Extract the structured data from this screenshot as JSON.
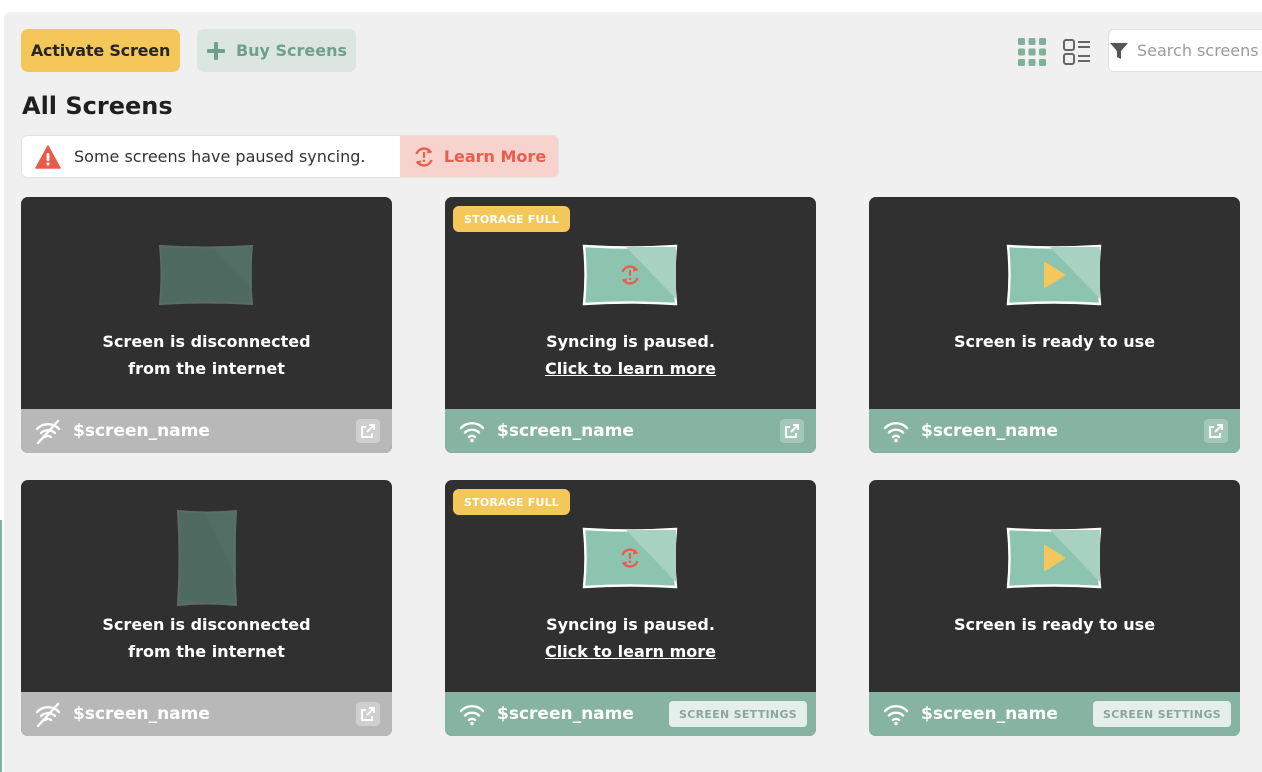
{
  "toolbar": {
    "activate_label": "Activate Screen",
    "buy_label": "Buy Screens",
    "search_placeholder": "Search screens"
  },
  "page": {
    "title": "All Screens"
  },
  "alert": {
    "message": "Some screens have paused syncing.",
    "learn_more_label": "Learn More"
  },
  "colors": {
    "accent_yellow": "#f4c75a",
    "accent_green": "#87b4a2",
    "alert_red": "#ea5d4b",
    "card_dark": "#2f302f",
    "offline_gray": "#b8b8b8"
  },
  "cards": [
    {
      "state": "disconnected",
      "orientation": "landscape",
      "status_line1": "Screen is disconnected",
      "status_line2": "from the internet",
      "name": "$screen_name",
      "connection_icon": "wifi-off-icon",
      "action_icon": "external-link-icon"
    },
    {
      "state": "paused",
      "orientation": "landscape",
      "badge": "STORAGE FULL",
      "status_line1": "Syncing is paused.",
      "status_link": "Click to learn more",
      "name": "$screen_name",
      "connection_icon": "wifi-icon",
      "action_icon": "external-link-icon"
    },
    {
      "state": "ready",
      "orientation": "landscape",
      "status_line1": "Screen is ready to use",
      "name": "$screen_name",
      "connection_icon": "wifi-icon",
      "action_icon": "external-link-icon"
    },
    {
      "state": "disconnected",
      "orientation": "portrait",
      "status_line1": "Screen is disconnected",
      "status_line2": "from the internet",
      "name": "$screen_name",
      "connection_icon": "wifi-off-icon",
      "action_icon": "external-link-icon"
    },
    {
      "state": "paused",
      "orientation": "landscape",
      "badge": "STORAGE FULL",
      "status_line1": "Syncing is paused.",
      "status_link": "Click to learn more",
      "name": "$screen_name",
      "connection_icon": "wifi-icon",
      "settings_label": "SCREEN SETTINGS"
    },
    {
      "state": "ready",
      "orientation": "landscape",
      "status_line1": "Screen is ready to use",
      "name": "$screen_name",
      "connection_icon": "wifi-icon",
      "settings_label": "SCREEN SETTINGS"
    }
  ]
}
